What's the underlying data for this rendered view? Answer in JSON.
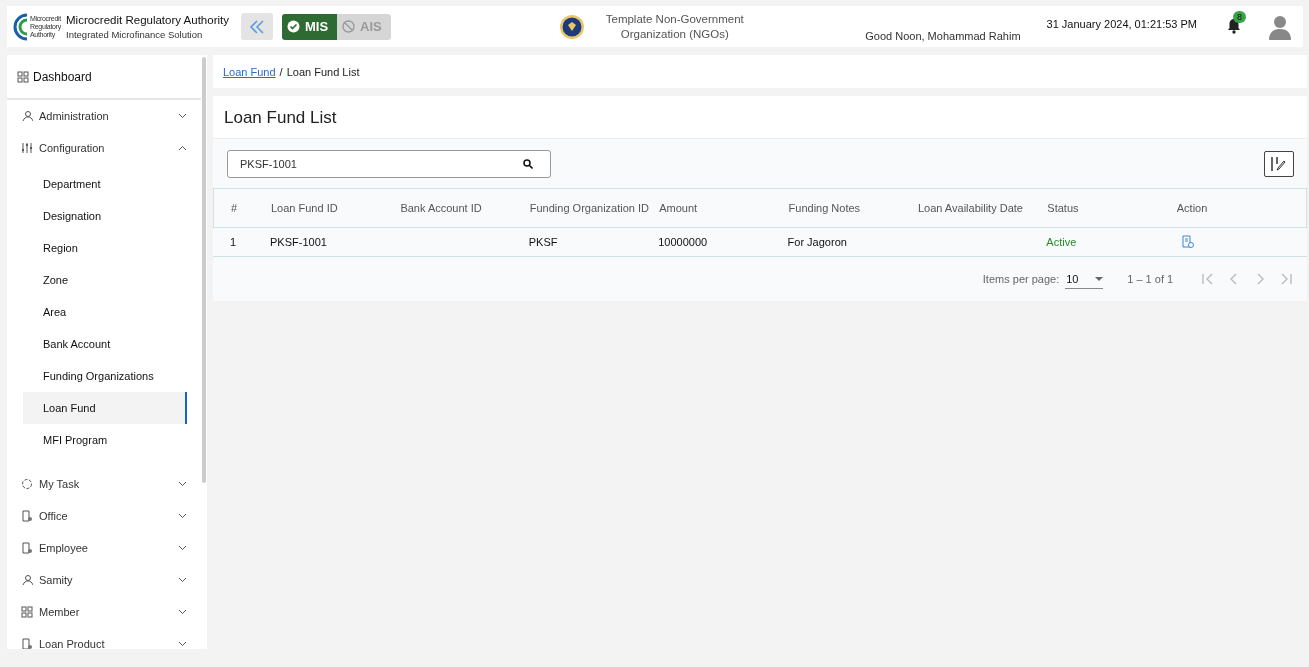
{
  "header": {
    "org_name": "Microcredit Regulatory Authority",
    "org_sub": "Integrated Microfinance Solution",
    "logo_text": [
      "Microcredit",
      "Regulatory",
      "Authority"
    ],
    "modes": [
      {
        "label": "MIS",
        "selected": true
      },
      {
        "label": "AIS",
        "selected": false
      }
    ],
    "tenant": "Template Non-Government Organization (NGOs)",
    "greeting": "Good Noon, Mohammad Rahim",
    "datetime": "31 January 2024, 01:21:53 PM",
    "notification_count": "8"
  },
  "sidebar": {
    "items": [
      {
        "kind": "link",
        "label": "Dashboard"
      },
      {
        "kind": "group",
        "label": "Administration",
        "expanded": false
      },
      {
        "kind": "group",
        "label": "Configuration",
        "expanded": true,
        "children": [
          {
            "label": "Department",
            "selected": false
          },
          {
            "label": "Designation",
            "selected": false
          },
          {
            "label": "Region",
            "selected": false
          },
          {
            "label": "Zone",
            "selected": false
          },
          {
            "label": "Area",
            "selected": false
          },
          {
            "label": "Bank Account",
            "selected": false
          },
          {
            "label": "Funding Organizations",
            "selected": false
          },
          {
            "label": "Loan Fund",
            "selected": true
          },
          {
            "label": "MFI Program",
            "selected": false
          }
        ]
      },
      {
        "kind": "group",
        "label": "My Task",
        "expanded": false
      },
      {
        "kind": "group",
        "label": "Office",
        "expanded": false
      },
      {
        "kind": "group",
        "label": "Employee",
        "expanded": false
      },
      {
        "kind": "group",
        "label": "Samity",
        "expanded": false
      },
      {
        "kind": "group",
        "label": "Member",
        "expanded": false
      },
      {
        "kind": "group",
        "label": "Loan Product",
        "expanded": false
      }
    ]
  },
  "breadcrumb": [
    {
      "label": "Loan Fund",
      "kind": "link"
    },
    {
      "label": "/",
      "kind": "separator"
    },
    {
      "label": "Loan Fund List",
      "kind": "current"
    }
  ],
  "page_title": "Loan Fund List",
  "search": {
    "value": "PKSF-1001"
  },
  "table": {
    "columns": [
      "#",
      "Loan Fund ID",
      "Bank Account ID",
      "Funding Organization ID",
      "Amount",
      "Funding Notes",
      "Loan Availability Date",
      "Status",
      "Action"
    ],
    "rows": [
      {
        "cells": [
          "1",
          "PKSF-1001",
          "",
          "PKSF",
          "10000000",
          "For Jagoron",
          ""
        ],
        "status": "Active",
        "active": true
      }
    ]
  },
  "paginator": {
    "label": "Items per page:",
    "page_size": "10",
    "range": "1 – 1 of 1",
    "buttons": [
      {
        "kind": "first",
        "disabled": true
      },
      {
        "kind": "prev",
        "disabled": true
      },
      {
        "kind": "next",
        "disabled": true
      },
      {
        "kind": "last",
        "disabled": true
      }
    ]
  }
}
